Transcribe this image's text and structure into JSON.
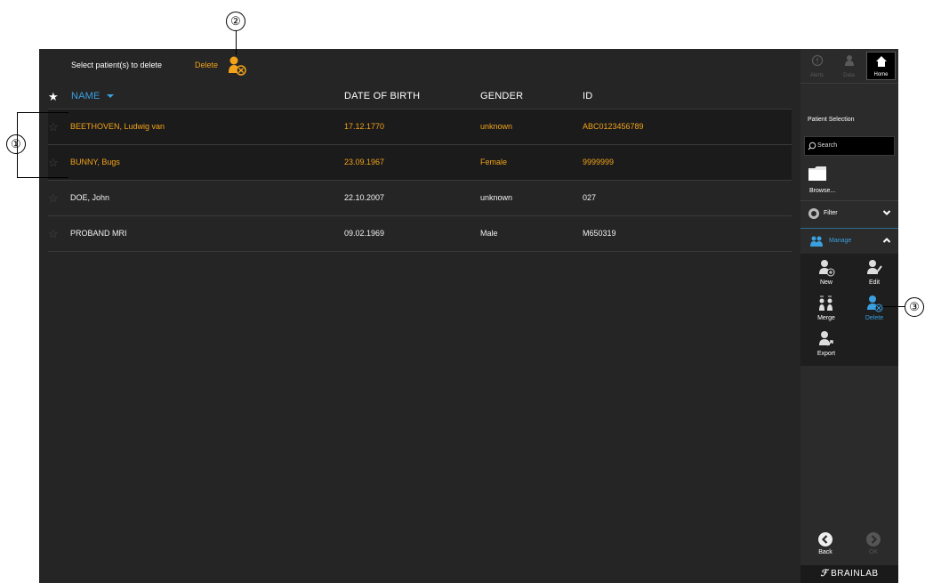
{
  "topbar": {
    "prompt": "Select patient(s) to delete",
    "delete_label": "Delete"
  },
  "table": {
    "headers": {
      "name": "NAME",
      "dob": "DATE OF BIRTH",
      "gender": "GENDER",
      "id": "ID"
    },
    "rows": [
      {
        "name": "BEETHOVEN, Ludwig van",
        "dob": "17.12.1770",
        "gender": "unknown",
        "id": "ABC0123456789",
        "selected": true
      },
      {
        "name": "BUNNY, Bugs",
        "dob": "23.09.1967",
        "gender": "Female",
        "id": "9999999",
        "selected": true
      },
      {
        "name": "DOE, John",
        "dob": "22.10.2007",
        "gender": "unknown",
        "id": "027",
        "selected": false
      },
      {
        "name": "PROBAND MRI",
        "dob": "09.02.1969",
        "gender": "Male",
        "id": "M650319",
        "selected": false
      }
    ]
  },
  "sidebar": {
    "tabs": {
      "alerts": "Alerts",
      "data": "Data",
      "home": "Home"
    },
    "section_title": "Patient Selection",
    "search_placeholder": "Search",
    "browse_label": "Browse...",
    "filter_label": "Filter",
    "manage_label": "Manage",
    "manage_buttons": {
      "new": "New",
      "edit": "Edit",
      "merge": "Merge",
      "delete": "Delete",
      "export": "Export"
    },
    "nav": {
      "back": "Back",
      "ok": "OK"
    },
    "brand": "BRAINLAB"
  },
  "callouts": {
    "one": "①",
    "two": "②",
    "three": "③"
  },
  "colors": {
    "accent_orange": "#f2a31b",
    "accent_blue": "#3aa0e0",
    "background": "#252525"
  }
}
